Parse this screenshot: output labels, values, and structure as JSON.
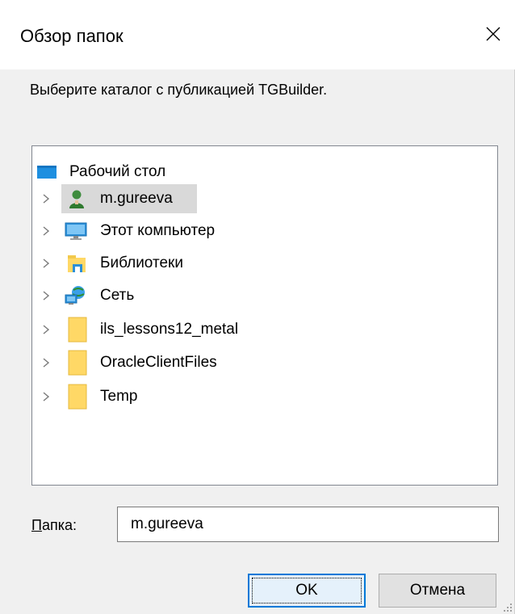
{
  "window": {
    "title": "Обзор папок",
    "close_icon": "close-x-icon"
  },
  "instruction": "Выберите каталог с публикацией TGBuilder.",
  "tree": {
    "root": {
      "label": "Рабочий стол",
      "icon": "desktop-icon"
    },
    "items": [
      {
        "label": "m.gureeva",
        "icon": "user-icon",
        "selected": true
      },
      {
        "label": "Этот компьютер",
        "icon": "computer-icon"
      },
      {
        "label": "Библиотеки",
        "icon": "libraries-icon"
      },
      {
        "label": "Сеть",
        "icon": "network-icon"
      },
      {
        "label": "ils_lessons12_metal",
        "icon": "folder-icon"
      },
      {
        "label": "OracleClientFiles",
        "icon": "folder-icon"
      },
      {
        "label": "Temp",
        "icon": "folder-icon"
      }
    ]
  },
  "folder": {
    "label_underlined": "П",
    "label_rest": "апка:",
    "value": "m.gureeva"
  },
  "buttons": {
    "ok": "OK",
    "cancel": "Отмена"
  },
  "colors": {
    "accent": "#0078d7",
    "selection": "#d9d9d9",
    "folder_yellow": "#ffd866"
  }
}
